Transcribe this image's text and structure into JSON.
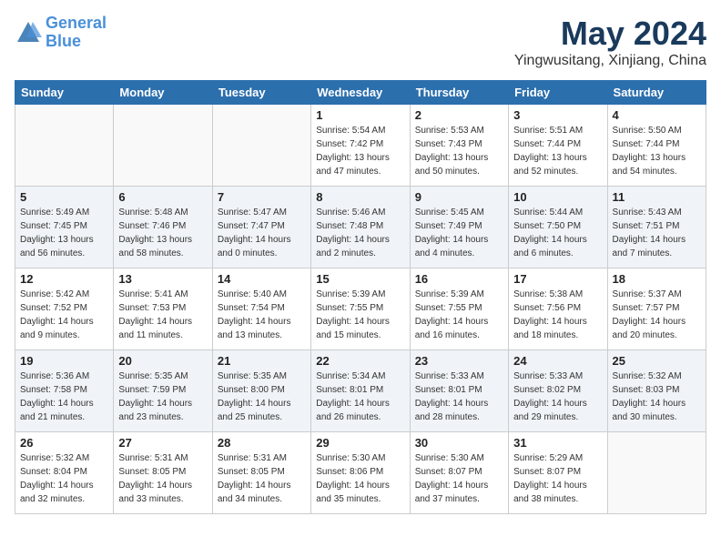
{
  "logo": {
    "text_general": "General",
    "text_blue": "Blue"
  },
  "header": {
    "month": "May 2024",
    "location": "Yingwusitang, Xinjiang, China"
  },
  "days_of_week": [
    "Sunday",
    "Monday",
    "Tuesday",
    "Wednesday",
    "Thursday",
    "Friday",
    "Saturday"
  ],
  "weeks": [
    [
      {
        "day": "",
        "info": "",
        "empty": true
      },
      {
        "day": "",
        "info": "",
        "empty": true
      },
      {
        "day": "",
        "info": "",
        "empty": true
      },
      {
        "day": "1",
        "info": "Sunrise: 5:54 AM\nSunset: 7:42 PM\nDaylight: 13 hours\nand 47 minutes.",
        "empty": false
      },
      {
        "day": "2",
        "info": "Sunrise: 5:53 AM\nSunset: 7:43 PM\nDaylight: 13 hours\nand 50 minutes.",
        "empty": false
      },
      {
        "day": "3",
        "info": "Sunrise: 5:51 AM\nSunset: 7:44 PM\nDaylight: 13 hours\nand 52 minutes.",
        "empty": false
      },
      {
        "day": "4",
        "info": "Sunrise: 5:50 AM\nSunset: 7:44 PM\nDaylight: 13 hours\nand 54 minutes.",
        "empty": false
      }
    ],
    [
      {
        "day": "5",
        "info": "Sunrise: 5:49 AM\nSunset: 7:45 PM\nDaylight: 13 hours\nand 56 minutes.",
        "empty": false
      },
      {
        "day": "6",
        "info": "Sunrise: 5:48 AM\nSunset: 7:46 PM\nDaylight: 13 hours\nand 58 minutes.",
        "empty": false
      },
      {
        "day": "7",
        "info": "Sunrise: 5:47 AM\nSunset: 7:47 PM\nDaylight: 14 hours\nand 0 minutes.",
        "empty": false
      },
      {
        "day": "8",
        "info": "Sunrise: 5:46 AM\nSunset: 7:48 PM\nDaylight: 14 hours\nand 2 minutes.",
        "empty": false
      },
      {
        "day": "9",
        "info": "Sunrise: 5:45 AM\nSunset: 7:49 PM\nDaylight: 14 hours\nand 4 minutes.",
        "empty": false
      },
      {
        "day": "10",
        "info": "Sunrise: 5:44 AM\nSunset: 7:50 PM\nDaylight: 14 hours\nand 6 minutes.",
        "empty": false
      },
      {
        "day": "11",
        "info": "Sunrise: 5:43 AM\nSunset: 7:51 PM\nDaylight: 14 hours\nand 7 minutes.",
        "empty": false
      }
    ],
    [
      {
        "day": "12",
        "info": "Sunrise: 5:42 AM\nSunset: 7:52 PM\nDaylight: 14 hours\nand 9 minutes.",
        "empty": false
      },
      {
        "day": "13",
        "info": "Sunrise: 5:41 AM\nSunset: 7:53 PM\nDaylight: 14 hours\nand 11 minutes.",
        "empty": false
      },
      {
        "day": "14",
        "info": "Sunrise: 5:40 AM\nSunset: 7:54 PM\nDaylight: 14 hours\nand 13 minutes.",
        "empty": false
      },
      {
        "day": "15",
        "info": "Sunrise: 5:39 AM\nSunset: 7:55 PM\nDaylight: 14 hours\nand 15 minutes.",
        "empty": false
      },
      {
        "day": "16",
        "info": "Sunrise: 5:39 AM\nSunset: 7:55 PM\nDaylight: 14 hours\nand 16 minutes.",
        "empty": false
      },
      {
        "day": "17",
        "info": "Sunrise: 5:38 AM\nSunset: 7:56 PM\nDaylight: 14 hours\nand 18 minutes.",
        "empty": false
      },
      {
        "day": "18",
        "info": "Sunrise: 5:37 AM\nSunset: 7:57 PM\nDaylight: 14 hours\nand 20 minutes.",
        "empty": false
      }
    ],
    [
      {
        "day": "19",
        "info": "Sunrise: 5:36 AM\nSunset: 7:58 PM\nDaylight: 14 hours\nand 21 minutes.",
        "empty": false
      },
      {
        "day": "20",
        "info": "Sunrise: 5:35 AM\nSunset: 7:59 PM\nDaylight: 14 hours\nand 23 minutes.",
        "empty": false
      },
      {
        "day": "21",
        "info": "Sunrise: 5:35 AM\nSunset: 8:00 PM\nDaylight: 14 hours\nand 25 minutes.",
        "empty": false
      },
      {
        "day": "22",
        "info": "Sunrise: 5:34 AM\nSunset: 8:01 PM\nDaylight: 14 hours\nand 26 minutes.",
        "empty": false
      },
      {
        "day": "23",
        "info": "Sunrise: 5:33 AM\nSunset: 8:01 PM\nDaylight: 14 hours\nand 28 minutes.",
        "empty": false
      },
      {
        "day": "24",
        "info": "Sunrise: 5:33 AM\nSunset: 8:02 PM\nDaylight: 14 hours\nand 29 minutes.",
        "empty": false
      },
      {
        "day": "25",
        "info": "Sunrise: 5:32 AM\nSunset: 8:03 PM\nDaylight: 14 hours\nand 30 minutes.",
        "empty": false
      }
    ],
    [
      {
        "day": "26",
        "info": "Sunrise: 5:32 AM\nSunset: 8:04 PM\nDaylight: 14 hours\nand 32 minutes.",
        "empty": false
      },
      {
        "day": "27",
        "info": "Sunrise: 5:31 AM\nSunset: 8:05 PM\nDaylight: 14 hours\nand 33 minutes.",
        "empty": false
      },
      {
        "day": "28",
        "info": "Sunrise: 5:31 AM\nSunset: 8:05 PM\nDaylight: 14 hours\nand 34 minutes.",
        "empty": false
      },
      {
        "day": "29",
        "info": "Sunrise: 5:30 AM\nSunset: 8:06 PM\nDaylight: 14 hours\nand 35 minutes.",
        "empty": false
      },
      {
        "day": "30",
        "info": "Sunrise: 5:30 AM\nSunset: 8:07 PM\nDaylight: 14 hours\nand 37 minutes.",
        "empty": false
      },
      {
        "day": "31",
        "info": "Sunrise: 5:29 AM\nSunset: 8:07 PM\nDaylight: 14 hours\nand 38 minutes.",
        "empty": false
      },
      {
        "day": "",
        "info": "",
        "empty": true
      }
    ]
  ]
}
